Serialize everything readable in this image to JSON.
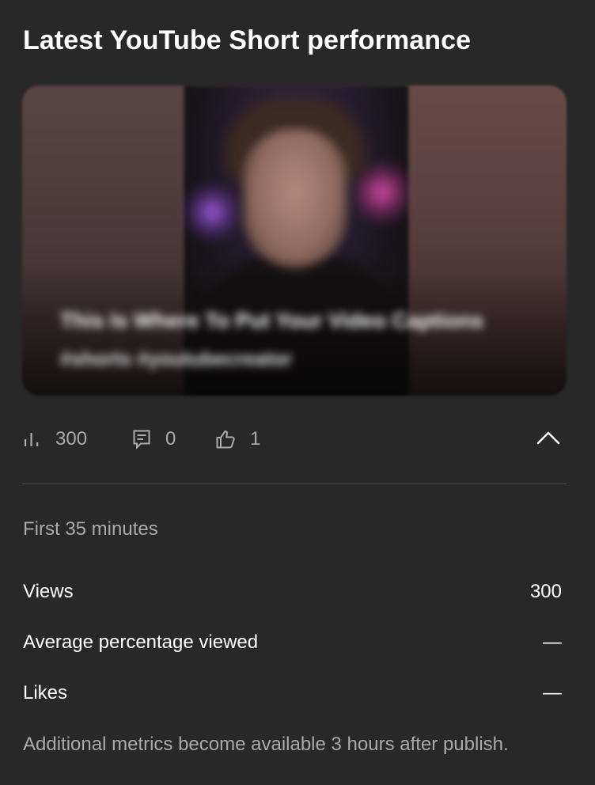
{
  "card": {
    "title": "Latest YouTube Short performance"
  },
  "video": {
    "title": "This Is Where To Put Your Video Captions",
    "channel": "#shorts #youtubecreator"
  },
  "stats": {
    "views": "300",
    "comments": "0",
    "likes": "1"
  },
  "period": "First 35 minutes",
  "metrics": [
    {
      "label": "Views",
      "value": "300"
    },
    {
      "label": "Average percentage viewed",
      "value": "—"
    },
    {
      "label": "Likes",
      "value": "—"
    }
  ],
  "footnote": "Additional metrics become available 3 hours after publish.",
  "icons": {
    "views": "bar-chart-icon",
    "comments": "comment-icon",
    "likes": "thumbs-up-icon",
    "collapse": "chevron-up-icon"
  },
  "colors": {
    "background": "#282828",
    "primary_text": "#ffffff",
    "secondary_text": "#aaaaaa",
    "divider": "#4a4a4a"
  }
}
